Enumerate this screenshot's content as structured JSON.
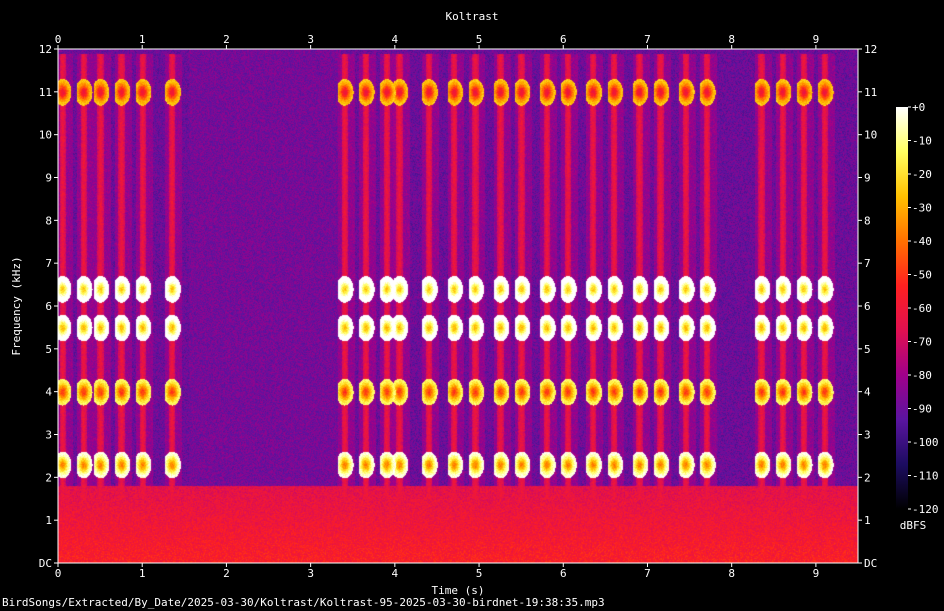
{
  "title": "Koltrast",
  "file_path": "BirdSongs/Extracted/By_Date/2025-03-30/Koltrast/Koltrast-95-2025-03-30-birdnet-19:38:35.mp3",
  "chart_data": {
    "type": "heatmap",
    "title": "Koltrast",
    "xlabel": "Time (s)",
    "ylabel": "Frequency (kHz)",
    "xlim": [
      0,
      9.5
    ],
    "ylim": [
      0,
      12
    ],
    "x_ticks": [
      {
        "value": 0,
        "label": "0"
      },
      {
        "value": 1,
        "label": "1"
      },
      {
        "value": 2,
        "label": "2"
      },
      {
        "value": 3,
        "label": "3"
      },
      {
        "value": 4,
        "label": "4"
      },
      {
        "value": 5,
        "label": "5"
      },
      {
        "value": 6,
        "label": "6"
      },
      {
        "value": 7,
        "label": "7"
      },
      {
        "value": 8,
        "label": "8"
      },
      {
        "value": 9,
        "label": "9"
      }
    ],
    "y_ticks": [
      {
        "value": 0,
        "label": "DC"
      },
      {
        "value": 1,
        "label": "1"
      },
      {
        "value": 2,
        "label": "2"
      },
      {
        "value": 3,
        "label": "3"
      },
      {
        "value": 4,
        "label": "4"
      },
      {
        "value": 5,
        "label": "5"
      },
      {
        "value": 6,
        "label": "6"
      },
      {
        "value": 7,
        "label": "7"
      },
      {
        "value": 8,
        "label": "8"
      },
      {
        "value": 9,
        "label": "9"
      },
      {
        "value": 10,
        "label": "10"
      },
      {
        "value": 11,
        "label": "11"
      },
      {
        "value": 12,
        "label": "12"
      }
    ],
    "colorbar": {
      "unit_label": "dBFS",
      "range": [
        -120,
        0
      ],
      "ticks": [
        {
          "value": 0,
          "label": "+0"
        },
        {
          "value": -10,
          "label": "-10"
        },
        {
          "value": -20,
          "label": "-20"
        },
        {
          "value": -30,
          "label": "-30"
        },
        {
          "value": -40,
          "label": "-40"
        },
        {
          "value": -50,
          "label": "-50"
        },
        {
          "value": -60,
          "label": "-60"
        },
        {
          "value": -70,
          "label": "-70"
        },
        {
          "value": -80,
          "label": "-80"
        },
        {
          "value": -90,
          "label": "-90"
        },
        {
          "value": -100,
          "label": "-100"
        },
        {
          "value": -110,
          "label": "-110"
        },
        {
          "value": -120,
          "label": "-120"
        }
      ],
      "colors": [
        "#ffffff",
        "#ffff60",
        "#ffc000",
        "#ff7000",
        "#ff2020",
        "#e01050",
        "#a0008a",
        "#5a14a0",
        "#1c0c60",
        "#000000"
      ]
    },
    "background_db": -90,
    "low_band": {
      "top_khz": 1.8,
      "db": -55
    },
    "quiet_interval": {
      "start_s": 1.55,
      "end_s": 3.35
    },
    "call_times_s": [
      0.05,
      0.3,
      0.5,
      0.75,
      1.0,
      1.35,
      3.4,
      3.65,
      3.9,
      4.05,
      4.4,
      4.7,
      4.95,
      5.25,
      5.5,
      5.8,
      6.05,
      6.35,
      6.6,
      6.9,
      7.15,
      7.45,
      7.7,
      8.35,
      8.6,
      8.85,
      9.1
    ],
    "harmonic_bands_khz": [
      {
        "f": 2.3,
        "db": -38
      },
      {
        "f": 4.0,
        "db": -50
      },
      {
        "f": 5.5,
        "db": -28
      },
      {
        "f": 6.4,
        "db": -25
      },
      {
        "f": 11.0,
        "db": -62
      }
    ]
  }
}
